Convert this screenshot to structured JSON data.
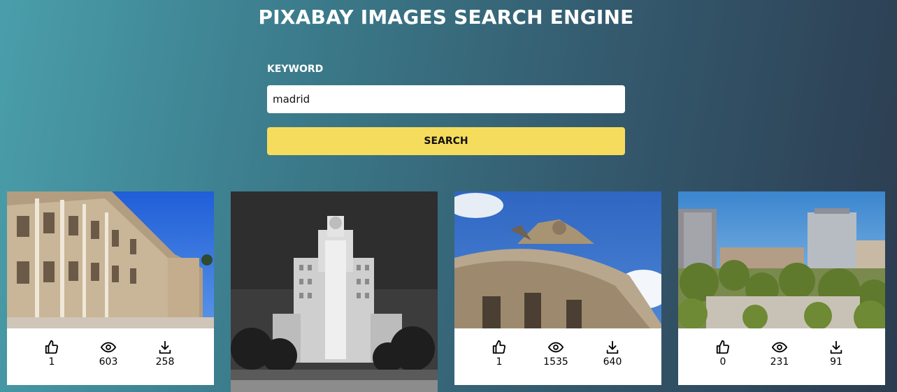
{
  "header": {
    "title": "PIXABAY IMAGES SEARCH ENGINE"
  },
  "search": {
    "keyword_label": "KEYWORD",
    "keyword_value": "madrid",
    "button_label": "SEARCH"
  },
  "results": [
    {
      "likes": "1",
      "views": "603",
      "downloads": "258"
    },
    {
      "likes": "",
      "views": "",
      "downloads": ""
    },
    {
      "likes": "1",
      "views": "1535",
      "downloads": "640"
    },
    {
      "likes": "0",
      "views": "231",
      "downloads": "91"
    }
  ],
  "icons": {
    "likes": "thumbs-up-icon",
    "views": "eye-icon",
    "downloads": "download-icon"
  },
  "colors": {
    "accent": "#f6dc5c",
    "card_bg": "#ffffff"
  }
}
